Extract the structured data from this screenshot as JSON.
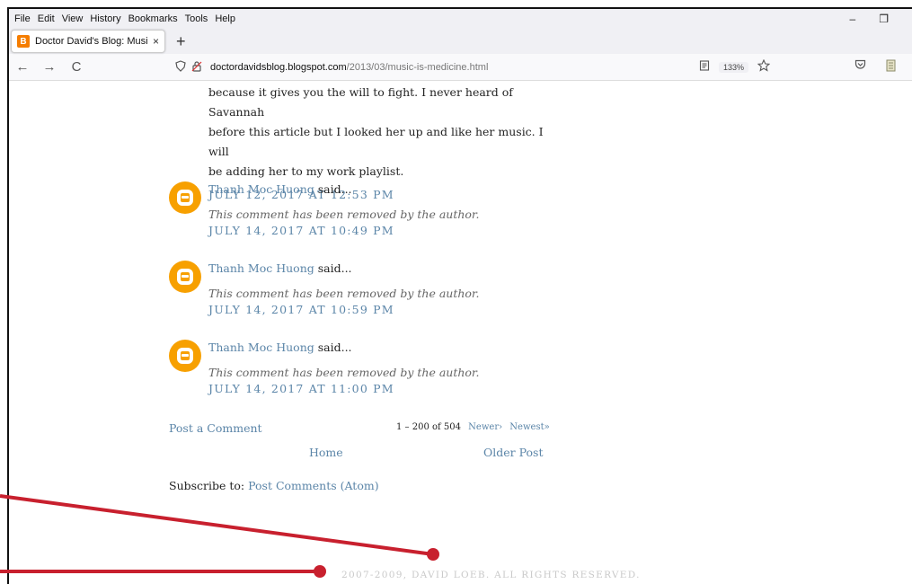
{
  "menubar": {
    "items": [
      "File",
      "Edit",
      "View",
      "History",
      "Bookmarks",
      "Tools",
      "Help"
    ],
    "minimize": "–",
    "restore": "❐"
  },
  "tab": {
    "favicon": "B",
    "title": "Doctor David's Blog: Music Is M",
    "close": "×",
    "new_tab": "+"
  },
  "navbar": {
    "back": "←",
    "forward": "→",
    "reload": "C",
    "url_host": "doctordavidsblog.blogspot.com",
    "url_path": "/2013/03/music-is-medicine.html",
    "zoom": "133%",
    "icons": [
      "shield-icon",
      "lock-icon",
      "reader-view-icon",
      "bookmark-star-icon",
      "pocket-icon",
      "extension-icon"
    ]
  },
  "first_comment": {
    "text_lines": [
      "because it gives you the will to fight. I never heard of Savannah",
      "before this article but I looked her up and like her music. I will",
      "be adding her to my work playlist."
    ],
    "timestamp": "JULY 12, 2017 AT 12:53 PM"
  },
  "comments": [
    {
      "author": "Thanh Moc Huong",
      "said": "said...",
      "text": "This comment has been removed by the author.",
      "timestamp": "JULY 14, 2017 AT 10:49 PM"
    },
    {
      "author": "Thanh Moc Huong",
      "said": "said...",
      "text": "This comment has been removed by the author.",
      "timestamp": "JULY 14, 2017 AT 10:59 PM"
    },
    {
      "author": "Thanh Moc Huong",
      "said": "said...",
      "text": "This comment has been removed by the author.",
      "timestamp": "JULY 14, 2017 AT 11:00 PM"
    }
  ],
  "pagination": {
    "post_comment": "Post a Comment",
    "range": "1 – 200 of 504",
    "newer": "Newer›",
    "newest": "Newest»"
  },
  "nav_links": {
    "home": "Home",
    "older": "Older Post"
  },
  "subscribe": {
    "label": "Subscribe to:",
    "link": "Post Comments (Atom)"
  },
  "footer": {
    "text": "2007-2009, DAVID LOEB. ALL RIGHTS RESERVED."
  },
  "colors": {
    "link": "#5b85a8",
    "annotation": "#c8202e",
    "avatar": "#f7a000"
  }
}
